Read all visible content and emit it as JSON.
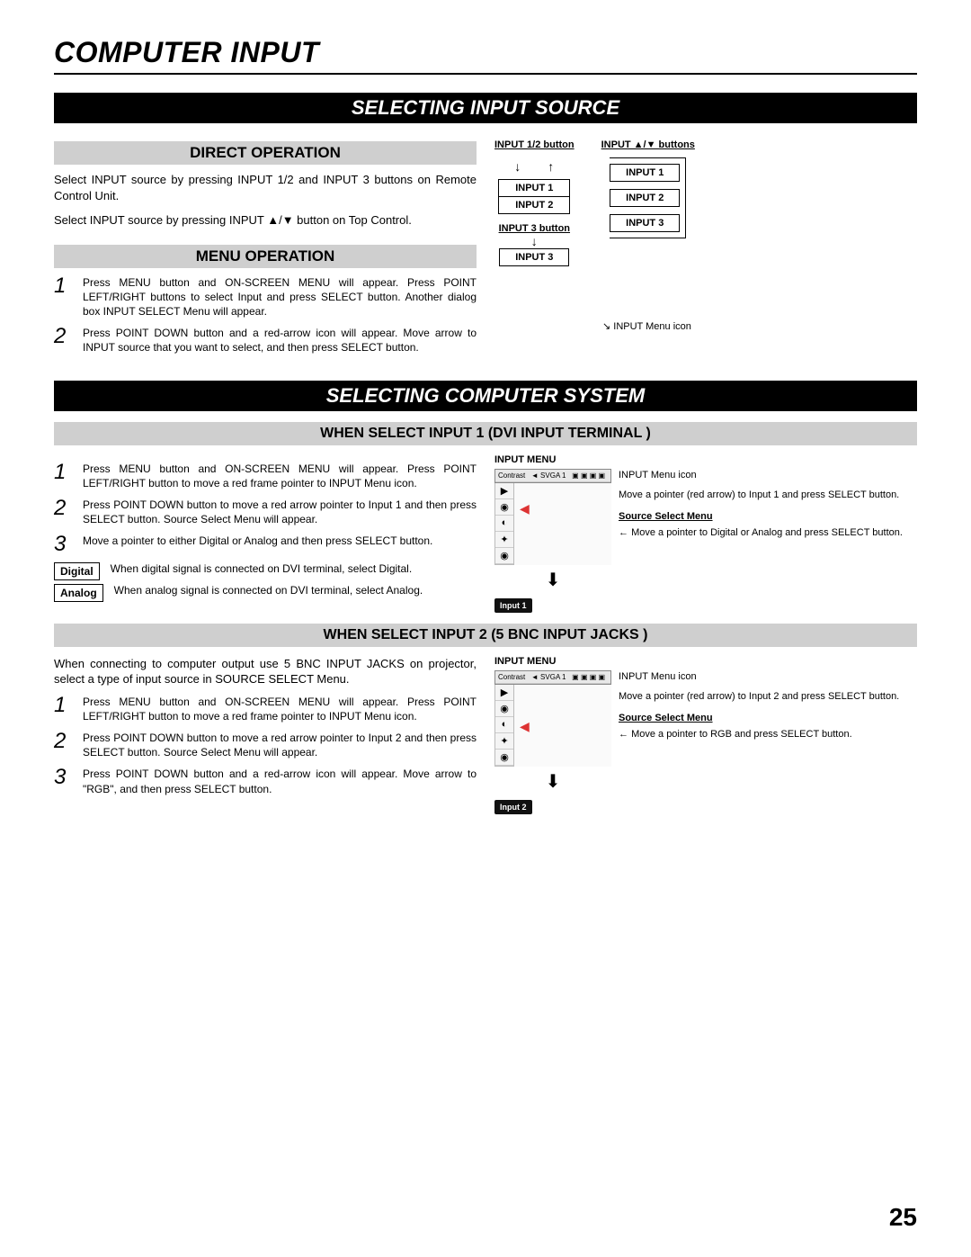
{
  "page": {
    "title": "COMPUTER INPUT",
    "number": "25"
  },
  "section1": {
    "heading": "SELECTING INPUT SOURCE",
    "direct": {
      "heading": "DIRECT OPERATION",
      "p1": "Select INPUT source by pressing INPUT 1/2 and INPUT 3 buttons on Remote Control Unit.",
      "p2": "Select INPUT source by pressing INPUT ▲/▼ button on Top Control."
    },
    "menu": {
      "heading": "MENU OPERATION",
      "s1": "Press MENU button and ON-SCREEN MENU will appear.  Press POINT LEFT/RIGHT buttons to select Input and press  SELECT button.  Another dialog box INPUT SELECT Menu will appear.",
      "s2": "Press POINT DOWN button and a red-arrow icon will appear.  Move arrow to INPUT source that you want to select, and then press SELECT button."
    },
    "diagram": {
      "h1": "INPUT 1/2 button",
      "h2": "INPUT ▲/▼  buttons",
      "i1": "INPUT 1",
      "i2": "INPUT 2",
      "i3": "INPUT 3",
      "h3": "INPUT 3 button",
      "note": "INPUT Menu icon"
    }
  },
  "section2": {
    "heading": "SELECTING COMPUTER SYSTEM",
    "sub1": {
      "heading": "WHEN SELECT  INPUT 1 (DVI INPUT TERMINAL )",
      "s1": "Press MENU button and ON-SCREEN MENU will appear.  Press POINT LEFT/RIGHT button to move a red frame pointer to INPUT Menu icon.",
      "s2": "Press POINT DOWN button to move a red arrow pointer to Input 1 and then press SELECT button.  Source Select Menu will appear.",
      "s3": "Move a pointer to either Digital or Analog and then press SELECT button.",
      "digital_label": "Digital",
      "digital_desc": "When digital signal is connected on DVI terminal, select Digital.",
      "analog_label": "Analog",
      "analog_desc": "When analog signal is connected on DVI terminal, select Analog."
    },
    "sub2": {
      "heading": "WHEN SELECT INPUT 2 (5 BNC INPUT JACKS )",
      "intro": "When connecting to computer output use 5 BNC INPUT JACKS on projector, select a type of input source in SOURCE SELECT Menu.",
      "s1": "Press MENU button and ON-SCREEN MENU will appear.  Press POINT LEFT/RIGHT button to move a red frame pointer to INPUT Menu icon.",
      "s2": "Press POINT DOWN button to move a red arrow pointer to Input 2 and then press SELECT button.  Source Select Menu will appear.",
      "s3": "Press POINT DOWN button and a red-arrow icon will appear.  Move arrow to \"RGB\", and then press SELECT button."
    },
    "menu_mock": {
      "title": "INPUT MENU",
      "header": "Contrast",
      "svga": "SVGA 1",
      "input1_box": "Input 1",
      "input2_box": "Input 2",
      "r1": "INPUT Menu icon",
      "r2a": "Move a pointer (red arrow) to Input 1 and press SELECT button.",
      "r2b": "Move a pointer (red arrow) to Input 2 and press SELECT button.",
      "r3_head": "Source Select Menu",
      "r3a": "Move a pointer to Digital or Analog and press SELECT button.",
      "r3b": "Move a pointer to RGB and press SELECT button."
    }
  }
}
